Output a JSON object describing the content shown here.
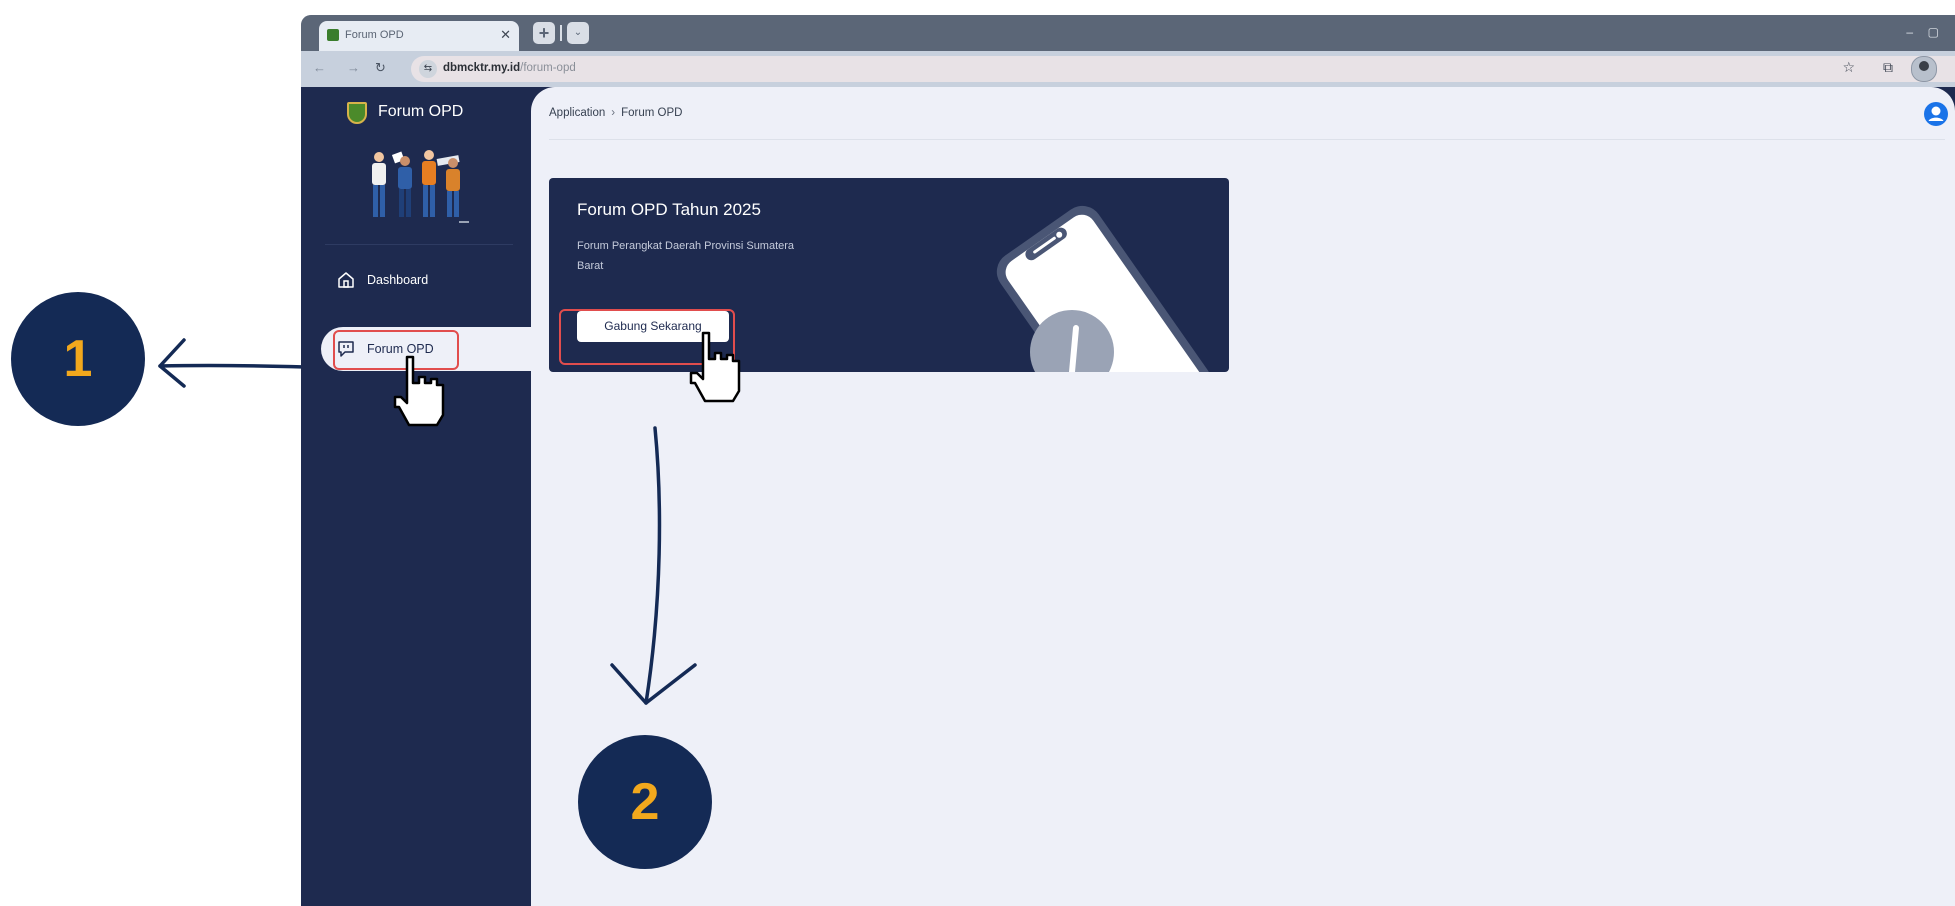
{
  "browser": {
    "tab_title": "Forum OPD",
    "url_host": "dbmcktr.my.id",
    "url_path": "/forum-opd"
  },
  "sidebar": {
    "app_name": "Forum OPD",
    "items": [
      {
        "label": "Dashboard",
        "icon": "home-icon",
        "active": false
      },
      {
        "label": "Forum OPD",
        "icon": "chat-icon",
        "active": true
      }
    ]
  },
  "main": {
    "breadcrumb": [
      "Application",
      "Forum OPD"
    ],
    "hero": {
      "title": "Forum OPD Tahun 2025",
      "subtitle": "Forum Perangkat Daerah Provinsi Sumatera Barat",
      "button_label": "Gabung Sekarang"
    }
  },
  "callouts": [
    {
      "number": "1"
    },
    {
      "number": "2"
    }
  ],
  "colors": {
    "navy": "#1e2a4f",
    "content_bg": "#eef0f8",
    "highlight": "#e14d4d",
    "callout_bg": "#142a55",
    "callout_text": "#f2a81d"
  }
}
